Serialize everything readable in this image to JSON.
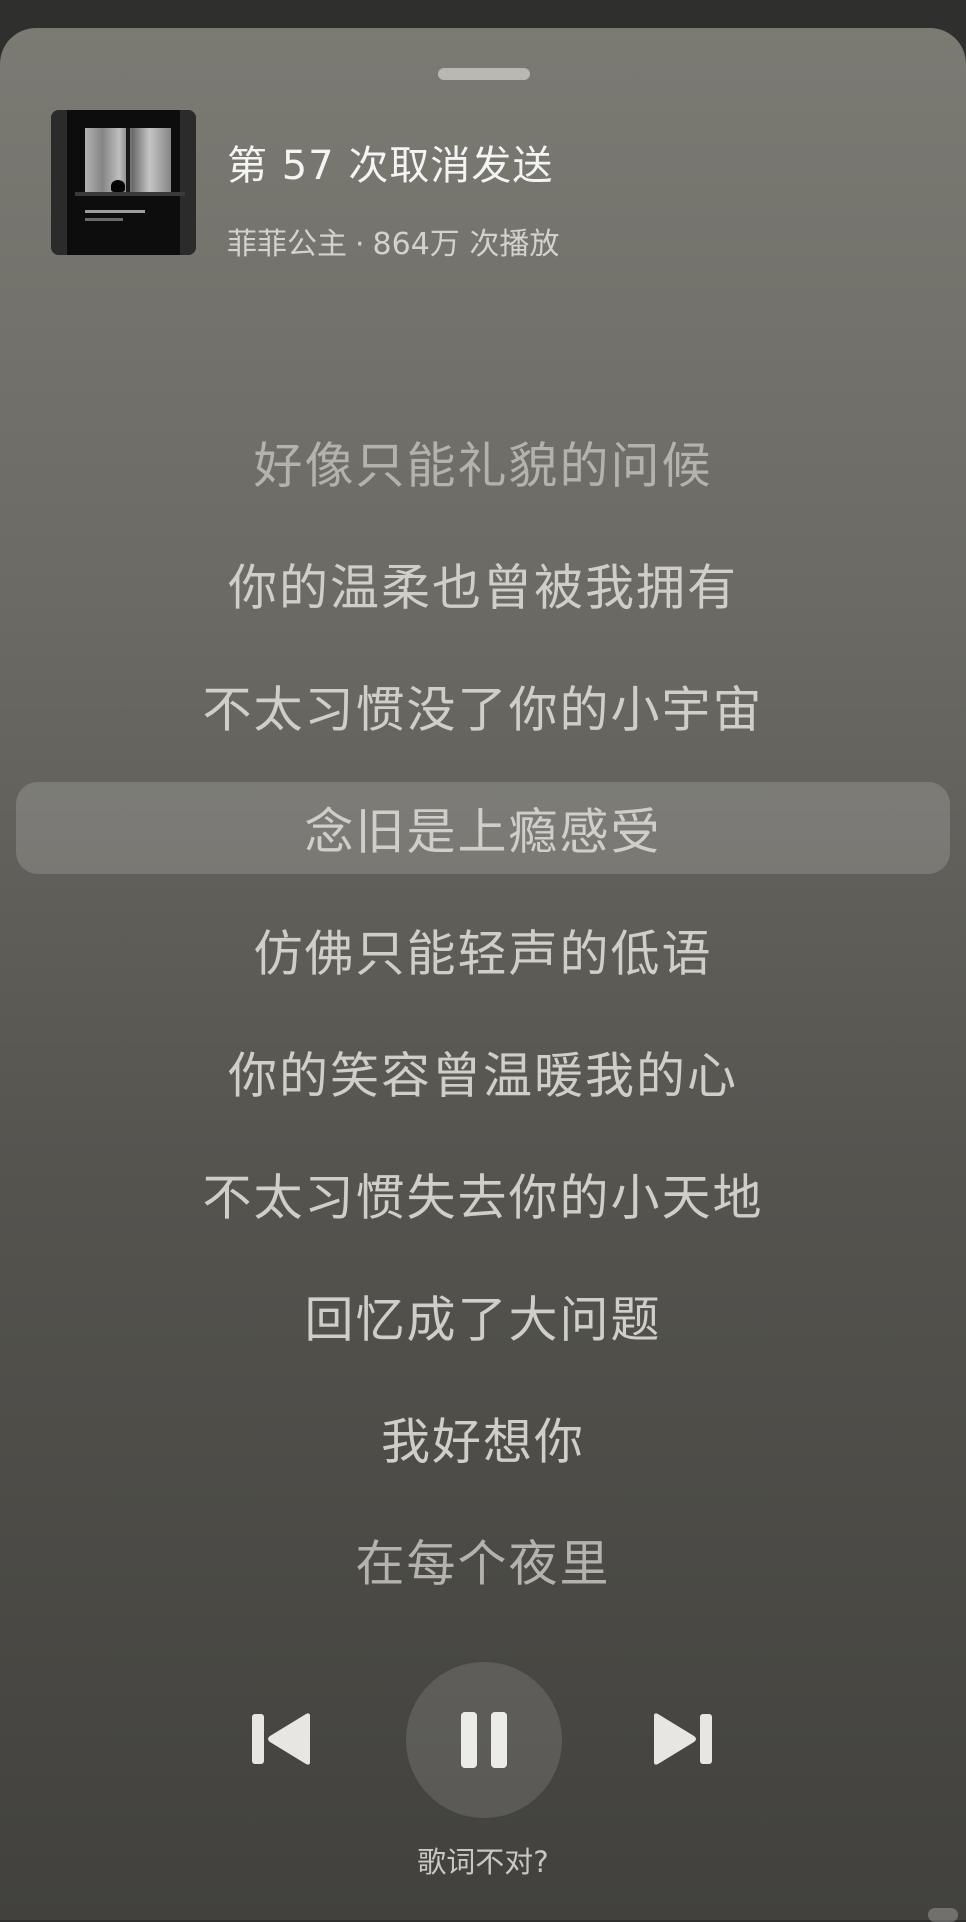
{
  "song": {
    "title": "第 57 次取消发送",
    "artist": "菲菲公主",
    "separator": "·",
    "play_count": "864万 次播放"
  },
  "lyrics": [
    {
      "text": "好像只能礼貌的问候",
      "active": false
    },
    {
      "text": "你的温柔也曾被我拥有",
      "active": false
    },
    {
      "text": "不太习惯没了你的小宇宙",
      "active": false
    },
    {
      "text": "念旧是上瘾感受",
      "active": true
    },
    {
      "text": "仿佛只能轻声的低语",
      "active": false
    },
    {
      "text": "你的笑容曾温暖我的心",
      "active": false
    },
    {
      "text": "不太习惯失去你的小天地",
      "active": false
    },
    {
      "text": "回忆成了大问题",
      "active": false
    },
    {
      "text": "我好想你",
      "active": false
    },
    {
      "text": "在每个夜里",
      "active": false
    }
  ],
  "controls": {
    "previous_icon": "skip-previous-icon",
    "play_pause_icon": "pause-icon",
    "next_icon": "skip-next-icon"
  },
  "footer": {
    "report_label": "歌词不对?"
  },
  "colors": {
    "title": "#f4f4f2",
    "lyric": "#cfcec8",
    "highlight_bg": "rgba(255,255,255,0.16)"
  }
}
